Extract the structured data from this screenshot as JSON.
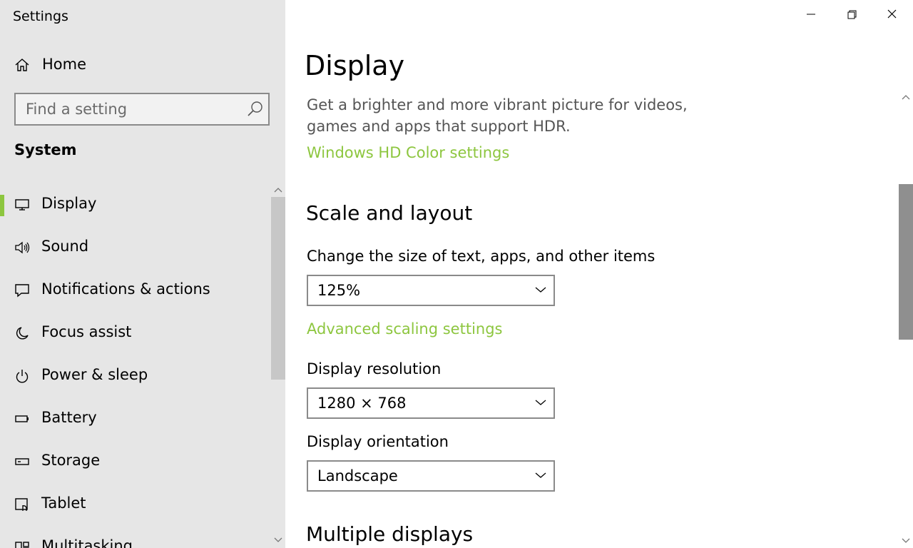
{
  "window": {
    "title": "Settings"
  },
  "sidebar": {
    "home_label": "Home",
    "search": {
      "placeholder": "Find a setting"
    },
    "section_title": "System",
    "items": [
      {
        "label": "Display",
        "icon": "monitor-icon",
        "active": true
      },
      {
        "label": "Sound",
        "icon": "speaker-icon"
      },
      {
        "label": "Notifications & actions",
        "icon": "notification-icon"
      },
      {
        "label": "Focus assist",
        "icon": "moon-icon"
      },
      {
        "label": "Power & sleep",
        "icon": "power-icon"
      },
      {
        "label": "Battery",
        "icon": "battery-icon"
      },
      {
        "label": "Storage",
        "icon": "storage-icon"
      },
      {
        "label": "Tablet",
        "icon": "tablet-icon"
      },
      {
        "label": "Multitasking",
        "icon": "multitasking-icon"
      }
    ]
  },
  "main": {
    "page_title": "Display",
    "hdr_description": "Get a brighter and more vibrant picture for videos, games and apps that support HDR.",
    "hdr_link": "Windows HD Color settings",
    "scale_section_title": "Scale and layout",
    "scale_label": "Change the size of text, apps, and other items",
    "scale_value": "125%",
    "advanced_scaling_link": "Advanced scaling settings",
    "resolution_label": "Display resolution",
    "resolution_value": "1280 × 768",
    "orientation_label": "Display orientation",
    "orientation_value": "Landscape",
    "multiple_displays_title": "Multiple displays"
  },
  "colors": {
    "accent": "#8dc63f",
    "sidebar_bg": "#e6e6e6",
    "description_text": "#555555"
  }
}
